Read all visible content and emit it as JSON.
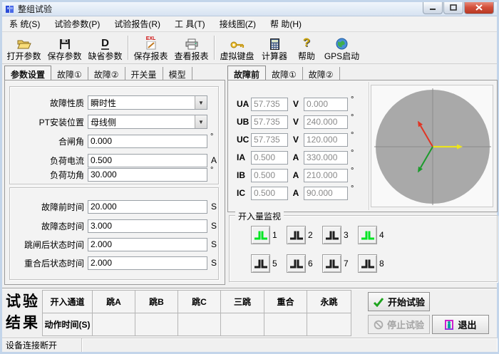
{
  "window": {
    "title": "整组试验"
  },
  "menu": {
    "items": [
      "系 统(S)",
      "试验参数(P)",
      "试验报告(R)",
      "工 具(T)",
      "接线图(Z)",
      "帮 助(H)"
    ]
  },
  "toolbar": {
    "buttons": [
      {
        "label": "打开参数",
        "icon": "folder-open-icon"
      },
      {
        "label": "保存参数",
        "icon": "floppy-icon"
      },
      {
        "label": "缺省参数",
        "icon": "letter-d-icon"
      },
      {
        "label": "保存报表",
        "icon": "excel-export-icon"
      },
      {
        "label": "查看报表",
        "icon": "printer-icon"
      },
      {
        "label": "虚拟键盘",
        "icon": "key-icon"
      },
      {
        "label": "计算器",
        "icon": "calculator-icon"
      },
      {
        "label": "帮助",
        "icon": "help-icon"
      },
      {
        "label": "GPS启动",
        "icon": "globe-icon"
      }
    ]
  },
  "icons": {
    "combo_arrow": "▼",
    "letter_d": "D",
    "excel_tag": "EXL",
    "help_mark": "?"
  },
  "left_panel": {
    "tabs": [
      "参数设置",
      "故障①",
      "故障②",
      "开关量",
      "模型"
    ],
    "active_tab": "参数设置",
    "group1": {
      "rows": [
        {
          "label": "故障性质",
          "value": "瞬时性",
          "type": "combo"
        },
        {
          "label": "PT安装位置",
          "value": "母线侧",
          "type": "combo"
        },
        {
          "label": "合闸角",
          "value": "0.000",
          "unit": "°"
        },
        {
          "label": "负荷电流",
          "value": "0.500",
          "unit": "A"
        },
        {
          "label": "负荷功角",
          "value": "30.000",
          "unit": "°"
        }
      ]
    },
    "group2": {
      "rows": [
        {
          "label": "故障前时间",
          "value": "20.000",
          "unit": "S"
        },
        {
          "label": "故障态时间",
          "value": "3.000",
          "unit": "S"
        },
        {
          "label": "跳闸后状态时间",
          "value": "2.000",
          "unit": "S"
        },
        {
          "label": "重合后状态时间",
          "value": "2.000",
          "unit": "S"
        }
      ]
    }
  },
  "right_panel": {
    "tabs": [
      "故障前",
      "故障①",
      "故障②"
    ],
    "active_tab": "故障前",
    "channels": [
      {
        "name": "UA",
        "magnitude": "57.735",
        "unit": "V",
        "angle": "0.000",
        "angle_unit": "°"
      },
      {
        "name": "UB",
        "magnitude": "57.735",
        "unit": "V",
        "angle": "240.000",
        "angle_unit": "°"
      },
      {
        "name": "UC",
        "magnitude": "57.735",
        "unit": "V",
        "angle": "120.000",
        "angle_unit": "°"
      },
      {
        "name": "IA",
        "magnitude": "0.500",
        "unit": "A",
        "angle": "330.000",
        "angle_unit": "°"
      },
      {
        "name": "IB",
        "magnitude": "0.500",
        "unit": "A",
        "angle": "210.000",
        "angle_unit": "°"
      },
      {
        "name": "IC",
        "magnitude": "0.500",
        "unit": "A",
        "angle": "90.000",
        "angle_unit": "°"
      }
    ],
    "phasor": {
      "circle_color": "#a9a9a9",
      "axis_color": "#8c8c8c",
      "arrows": [
        {
          "name": "UA",
          "angle_deg": 0,
          "color": "#ece41e"
        },
        {
          "name": "UC",
          "angle_deg": 120,
          "color": "#e03524"
        },
        {
          "name": "UB",
          "angle_deg": 240,
          "color": "#1c9b2c"
        }
      ]
    }
  },
  "monitor": {
    "title": "开入量监视",
    "active_color": "#00e422",
    "inactive_color": "#1d1d1d",
    "channels": [
      {
        "num": "1",
        "active": true
      },
      {
        "num": "2",
        "active": false
      },
      {
        "num": "3",
        "active": false
      },
      {
        "num": "4",
        "active": true
      },
      {
        "num": "5",
        "active": false
      },
      {
        "num": "6",
        "active": false
      },
      {
        "num": "7",
        "active": false
      },
      {
        "num": "8",
        "active": false
      }
    ]
  },
  "results": {
    "title_line1": "试验",
    "title_line2": "结果",
    "header": [
      "开入通道",
      "跳A",
      "跳B",
      "跳C",
      "三跳",
      "重合",
      "永跳"
    ],
    "row_label": "动作时间(S)",
    "buttons": {
      "start": "开始试验",
      "stop": "停止试验",
      "exit": "退出"
    }
  },
  "statusbar": {
    "text": "设备连接断开"
  }
}
